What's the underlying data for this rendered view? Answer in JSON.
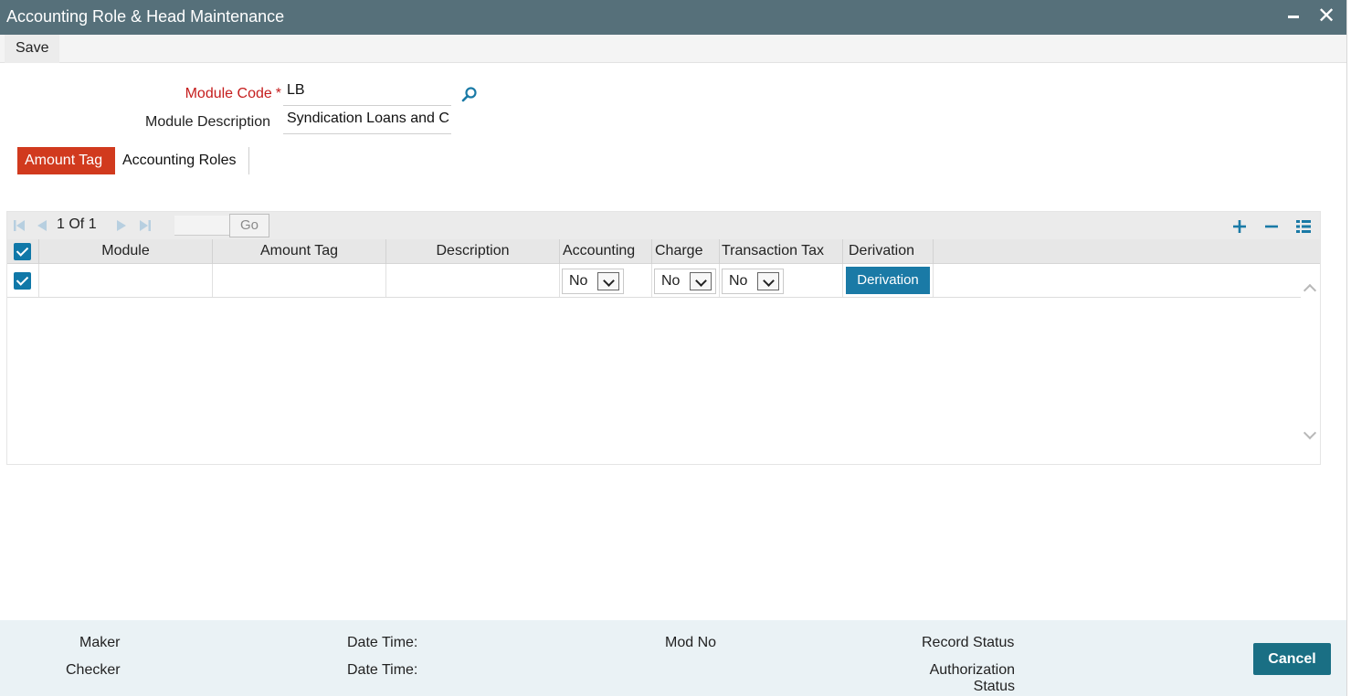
{
  "window": {
    "title": "Accounting Role & Head Maintenance",
    "minimize_icon": "minimize-icon",
    "close_icon": "close-icon",
    "close_glyph": "✕"
  },
  "menu": {
    "save_label": "Save"
  },
  "form": {
    "module_code_label": "Module Code",
    "required_mark": "*",
    "module_code_value": "LB",
    "module_description_label": "Module Description",
    "module_description_value": "Syndication Loans and C"
  },
  "tabs": [
    {
      "label": "Amount Tag",
      "active": true
    },
    {
      "label": "Accounting Roles",
      "active": false
    }
  ],
  "grid": {
    "pagination": {
      "current": "1",
      "of_label": "Of",
      "total": "1",
      "go_label": "Go"
    },
    "columns": [
      "Module",
      "Amount Tag",
      "Description",
      "Accounting",
      "Charge",
      "Transaction Tax",
      "Derivation"
    ],
    "rows": [
      {
        "checked": true,
        "module": "",
        "amount_tag": "",
        "description": "",
        "accounting": "No",
        "charge": "No",
        "transaction_tax": "No",
        "derivation_button": "Derivation"
      }
    ]
  },
  "footer": {
    "maker_label": "Maker",
    "maker_date_label": "Date Time:",
    "mod_no_label": "Mod No",
    "record_status_label": "Record Status",
    "checker_label": "Checker",
    "checker_date_label": "Date Time:",
    "authorization_status_line1": "Authorization",
    "authorization_status_line2": "Status",
    "cancel_label": "Cancel"
  },
  "colors": {
    "titlebar": "#56707a",
    "active_tab": "#d13a1e",
    "accent_blue": "#1a7aa6",
    "cancel_button": "#1a6f84",
    "required_red": "#c51d1d",
    "footer_bg": "#eaf2f5"
  }
}
